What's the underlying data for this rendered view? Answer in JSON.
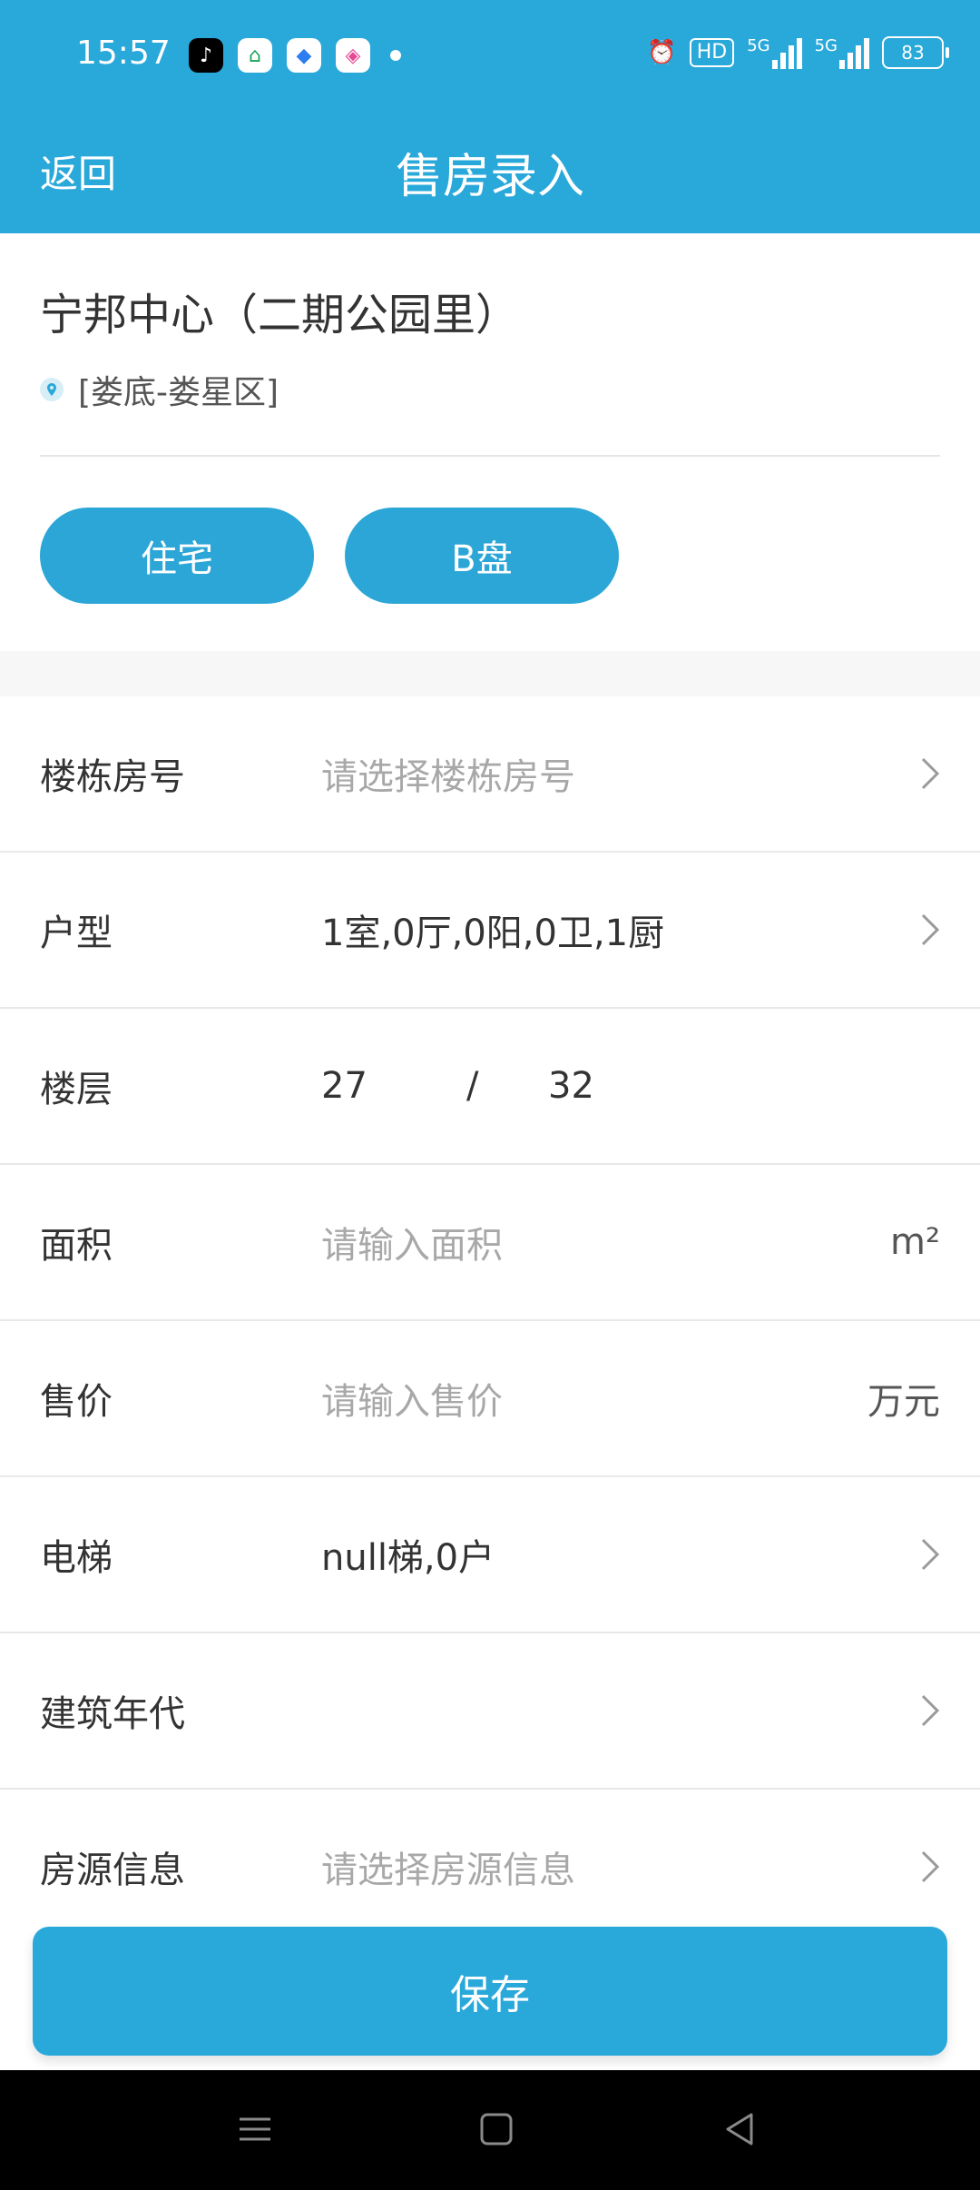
{
  "status_bar": {
    "time": "15:57",
    "battery": "83",
    "hd_label": "HD",
    "network_labels": [
      "5G",
      "5G"
    ]
  },
  "header": {
    "back_label": "返回",
    "title": "售房录入"
  },
  "project": {
    "name": "宁邦中心（二期公园里）",
    "location": "[娄底-娄星区]",
    "tags": [
      "住宅",
      "B盘"
    ]
  },
  "form": {
    "building": {
      "label": "楼栋房号",
      "placeholder": "请选择楼栋房号"
    },
    "layout": {
      "label": "户型",
      "value": "1室,0厅,0阳,0卫,1厨"
    },
    "floor": {
      "label": "楼层",
      "current": "27",
      "separator": "/",
      "total": "32"
    },
    "area": {
      "label": "面积",
      "placeholder": "请输入面积",
      "unit": "m²"
    },
    "price": {
      "label": "售价",
      "placeholder": "请输入售价",
      "unit": "万元"
    },
    "elevator": {
      "label": "电梯",
      "value": "null梯,0户"
    },
    "year": {
      "label": "建筑年代",
      "value": ""
    },
    "source": {
      "label": "房源信息",
      "placeholder": "请选择房源信息"
    }
  },
  "save_label": "保存",
  "colors": {
    "primary": "#29A8DA",
    "text": "#333333",
    "placeholder": "#A8A8A8",
    "divider": "#E8E8E8"
  },
  "icons": {
    "status_apps": [
      "tiktok-icon",
      "home-app-icon",
      "blue-app-icon",
      "pink-app-icon"
    ],
    "status_right": [
      "alarm-icon",
      "hd-icon",
      "signal-icon",
      "signal-icon",
      "battery-icon"
    ],
    "row_arrow": "chevron-right-icon",
    "location": "location-pin-icon",
    "nav": [
      "menu-icon",
      "home-square-icon",
      "back-triangle-icon"
    ]
  }
}
